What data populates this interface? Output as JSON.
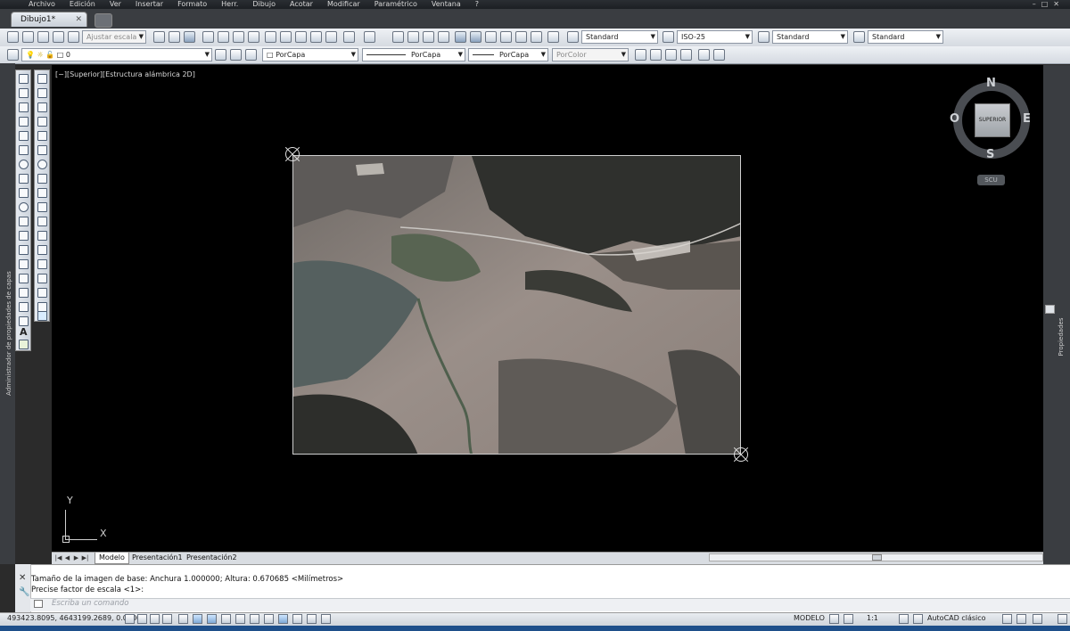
{
  "menubar": {
    "items": [
      "Archivo",
      "Edición",
      "Ver",
      "Insertar",
      "Formato",
      "Herr.",
      "Dibujo",
      "Acotar",
      "Modificar",
      "Paramétrico",
      "Ventana",
      "?"
    ]
  },
  "tabs": {
    "document": "Dibujo1*",
    "close": "✕"
  },
  "toolbar1": {
    "scale_placeholder": "Ajustar escala",
    "text_style": "Standard",
    "dim_style": "ISO-25",
    "table_style": "Standard",
    "multileader_style": "Standard"
  },
  "toolbar2": {
    "layer": "0",
    "color": "PorCapa",
    "linetype": "PorCapa",
    "lineweight": "PorCapa",
    "plotstyle": "PorColor"
  },
  "panels": {
    "left_label": "Administrador de propiedades de capas",
    "right_label": "Propiedades"
  },
  "viewport": {
    "label": "[−][Superior][Estructura alámbrica 2D]"
  },
  "viewcube": {
    "north": "N",
    "south": "S",
    "east": "E",
    "west": "O",
    "face": "SUPERIOR",
    "wcs": "SCU"
  },
  "ucs": {
    "x": "X",
    "y": "Y"
  },
  "layout_tabs": [
    "Modelo",
    "Presentación1",
    "Presentación2"
  ],
  "command": {
    "history": [
      "Tamaño de la imagen de base: Anchura 1.000000; Altura: 0.670685 <Milímetros>",
      "Precise factor de escala <1>:"
    ],
    "placeholder": "Escriba un comando"
  },
  "status": {
    "coords": "493423.8095, 4643199.2689, 0.0000",
    "space": "MODELO",
    "annotation_scale": "1:1",
    "workspace": "AutoCAD clásico"
  },
  "colors": {
    "canvas": "#000000",
    "chrome_dark": "#2b2b2b",
    "toolbar": "#dde2e8"
  }
}
